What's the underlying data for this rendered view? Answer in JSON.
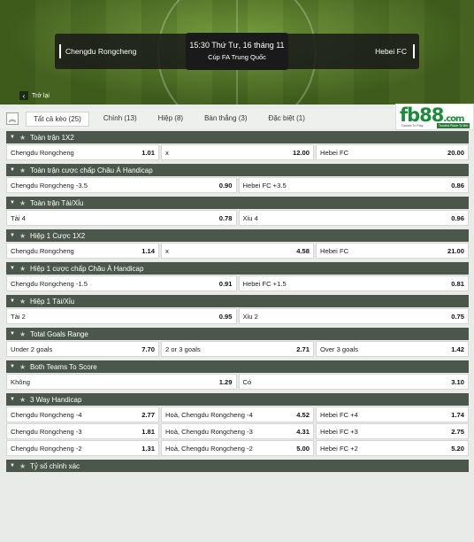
{
  "header": {
    "home_team": "Chengdu Rongcheng",
    "away_team": "Hebei FC",
    "match_time": "15:30 Thứ Tư, 16 tháng 11",
    "league": "Cúp FA Trung Quốc",
    "back_label": "Trở lại"
  },
  "tabs": [
    {
      "label": "Tất cả kèo (25)",
      "active": true
    },
    {
      "label": "Chính (13)"
    },
    {
      "label": "Hiệp (8)"
    },
    {
      "label": "Bàn thắng (3)"
    },
    {
      "label": "Đặc biệt (1)"
    }
  ],
  "logo": {
    "text": "fb88",
    "suffix": ".com",
    "tagline1": "Games To Play",
    "tagline2": "Trusted Place To Bet"
  },
  "markets": [
    {
      "title": "Toàn trận 1X2",
      "rows": [
        [
          [
            "Chengdu Rongcheng",
            "1.01"
          ],
          [
            "x",
            "12.00"
          ],
          [
            "Hebei FC",
            "20.00"
          ]
        ]
      ]
    },
    {
      "title": "Toàn trận cược chấp Châu Á Handicap",
      "rows": [
        [
          [
            "Chengdu Rongcheng -3.5",
            "0.90"
          ],
          [
            "Hebei FC +3.5",
            "0.86"
          ]
        ]
      ]
    },
    {
      "title": "Toàn trận Tài/Xỉu",
      "rows": [
        [
          [
            "Tài 4",
            "0.78"
          ],
          [
            "Xỉu 4",
            "0.96"
          ]
        ]
      ]
    },
    {
      "title": "Hiệp 1 Cược 1X2",
      "rows": [
        [
          [
            "Chengdu Rongcheng",
            "1.14"
          ],
          [
            "x",
            "4.58"
          ],
          [
            "Hebei FC",
            "21.00"
          ]
        ]
      ]
    },
    {
      "title": "Hiệp 1 cược chấp Châu Á Handicap",
      "rows": [
        [
          [
            "Chengdu Rongcheng -1.5",
            "0.91"
          ],
          [
            "Hebei FC +1.5",
            "0.81"
          ]
        ]
      ]
    },
    {
      "title": "Hiệp 1 Tài/Xỉu",
      "rows": [
        [
          [
            "Tài 2",
            "0.95"
          ],
          [
            "Xỉu 2",
            "0.75"
          ]
        ]
      ]
    },
    {
      "title": "Total Goals Range",
      "rows": [
        [
          [
            "Under 2 goals",
            "7.70"
          ],
          [
            "2 or 3 goals",
            "2.71"
          ],
          [
            "Over 3 goals",
            "1.42"
          ]
        ]
      ]
    },
    {
      "title": "Both Teams To Score",
      "rows": [
        [
          [
            "Không",
            "1.29"
          ],
          [
            "Có",
            "3.10"
          ]
        ]
      ]
    },
    {
      "title": "3 Way Handicap",
      "rows": [
        [
          [
            "Chengdu Rongcheng -4",
            "2.77"
          ],
          [
            "Hoà, Chengdu Rongcheng -4",
            "4.52"
          ],
          [
            "Hebei FC +4",
            "1.74"
          ]
        ],
        [
          [
            "Chengdu Rongcheng -3",
            "1.81"
          ],
          [
            "Hoà, Chengdu Rongcheng -3",
            "4.31"
          ],
          [
            "Hebei FC +3",
            "2.75"
          ]
        ],
        [
          [
            "Chengdu Rongcheng -2",
            "1.31"
          ],
          [
            "Hoà, Chengdu Rongcheng -2",
            "5.00"
          ],
          [
            "Hebei FC +2",
            "5.20"
          ]
        ]
      ]
    },
    {
      "title": "Tỷ số chính xác",
      "rows": []
    }
  ],
  "icons": {
    "back": "chevron-left-icon",
    "collapse": "double-chevron-up-icon",
    "star": "star-icon",
    "arrow": "triangle-down-icon"
  }
}
